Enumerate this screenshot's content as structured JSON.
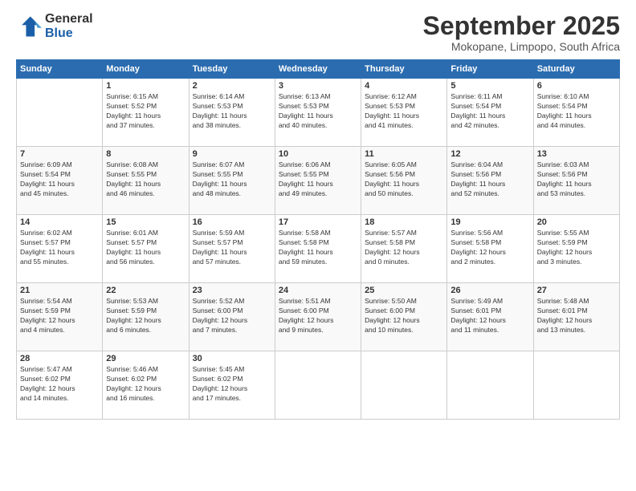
{
  "logo": {
    "line1": "General",
    "line2": "Blue"
  },
  "title": "September 2025",
  "location": "Mokopane, Limpopo, South Africa",
  "headers": [
    "Sunday",
    "Monday",
    "Tuesday",
    "Wednesday",
    "Thursday",
    "Friday",
    "Saturday"
  ],
  "weeks": [
    [
      {
        "day": "",
        "info": ""
      },
      {
        "day": "1",
        "info": "Sunrise: 6:15 AM\nSunset: 5:52 PM\nDaylight: 11 hours\nand 37 minutes."
      },
      {
        "day": "2",
        "info": "Sunrise: 6:14 AM\nSunset: 5:53 PM\nDaylight: 11 hours\nand 38 minutes."
      },
      {
        "day": "3",
        "info": "Sunrise: 6:13 AM\nSunset: 5:53 PM\nDaylight: 11 hours\nand 40 minutes."
      },
      {
        "day": "4",
        "info": "Sunrise: 6:12 AM\nSunset: 5:53 PM\nDaylight: 11 hours\nand 41 minutes."
      },
      {
        "day": "5",
        "info": "Sunrise: 6:11 AM\nSunset: 5:54 PM\nDaylight: 11 hours\nand 42 minutes."
      },
      {
        "day": "6",
        "info": "Sunrise: 6:10 AM\nSunset: 5:54 PM\nDaylight: 11 hours\nand 44 minutes."
      }
    ],
    [
      {
        "day": "7",
        "info": "Sunrise: 6:09 AM\nSunset: 5:54 PM\nDaylight: 11 hours\nand 45 minutes."
      },
      {
        "day": "8",
        "info": "Sunrise: 6:08 AM\nSunset: 5:55 PM\nDaylight: 11 hours\nand 46 minutes."
      },
      {
        "day": "9",
        "info": "Sunrise: 6:07 AM\nSunset: 5:55 PM\nDaylight: 11 hours\nand 48 minutes."
      },
      {
        "day": "10",
        "info": "Sunrise: 6:06 AM\nSunset: 5:55 PM\nDaylight: 11 hours\nand 49 minutes."
      },
      {
        "day": "11",
        "info": "Sunrise: 6:05 AM\nSunset: 5:56 PM\nDaylight: 11 hours\nand 50 minutes."
      },
      {
        "day": "12",
        "info": "Sunrise: 6:04 AM\nSunset: 5:56 PM\nDaylight: 11 hours\nand 52 minutes."
      },
      {
        "day": "13",
        "info": "Sunrise: 6:03 AM\nSunset: 5:56 PM\nDaylight: 11 hours\nand 53 minutes."
      }
    ],
    [
      {
        "day": "14",
        "info": "Sunrise: 6:02 AM\nSunset: 5:57 PM\nDaylight: 11 hours\nand 55 minutes."
      },
      {
        "day": "15",
        "info": "Sunrise: 6:01 AM\nSunset: 5:57 PM\nDaylight: 11 hours\nand 56 minutes."
      },
      {
        "day": "16",
        "info": "Sunrise: 5:59 AM\nSunset: 5:57 PM\nDaylight: 11 hours\nand 57 minutes."
      },
      {
        "day": "17",
        "info": "Sunrise: 5:58 AM\nSunset: 5:58 PM\nDaylight: 11 hours\nand 59 minutes."
      },
      {
        "day": "18",
        "info": "Sunrise: 5:57 AM\nSunset: 5:58 PM\nDaylight: 12 hours\nand 0 minutes."
      },
      {
        "day": "19",
        "info": "Sunrise: 5:56 AM\nSunset: 5:58 PM\nDaylight: 12 hours\nand 2 minutes."
      },
      {
        "day": "20",
        "info": "Sunrise: 5:55 AM\nSunset: 5:59 PM\nDaylight: 12 hours\nand 3 minutes."
      }
    ],
    [
      {
        "day": "21",
        "info": "Sunrise: 5:54 AM\nSunset: 5:59 PM\nDaylight: 12 hours\nand 4 minutes."
      },
      {
        "day": "22",
        "info": "Sunrise: 5:53 AM\nSunset: 5:59 PM\nDaylight: 12 hours\nand 6 minutes."
      },
      {
        "day": "23",
        "info": "Sunrise: 5:52 AM\nSunset: 6:00 PM\nDaylight: 12 hours\nand 7 minutes."
      },
      {
        "day": "24",
        "info": "Sunrise: 5:51 AM\nSunset: 6:00 PM\nDaylight: 12 hours\nand 9 minutes."
      },
      {
        "day": "25",
        "info": "Sunrise: 5:50 AM\nSunset: 6:00 PM\nDaylight: 12 hours\nand 10 minutes."
      },
      {
        "day": "26",
        "info": "Sunrise: 5:49 AM\nSunset: 6:01 PM\nDaylight: 12 hours\nand 11 minutes."
      },
      {
        "day": "27",
        "info": "Sunrise: 5:48 AM\nSunset: 6:01 PM\nDaylight: 12 hours\nand 13 minutes."
      }
    ],
    [
      {
        "day": "28",
        "info": "Sunrise: 5:47 AM\nSunset: 6:02 PM\nDaylight: 12 hours\nand 14 minutes."
      },
      {
        "day": "29",
        "info": "Sunrise: 5:46 AM\nSunset: 6:02 PM\nDaylight: 12 hours\nand 16 minutes."
      },
      {
        "day": "30",
        "info": "Sunrise: 5:45 AM\nSunset: 6:02 PM\nDaylight: 12 hours\nand 17 minutes."
      },
      {
        "day": "",
        "info": ""
      },
      {
        "day": "",
        "info": ""
      },
      {
        "day": "",
        "info": ""
      },
      {
        "day": "",
        "info": ""
      }
    ]
  ]
}
